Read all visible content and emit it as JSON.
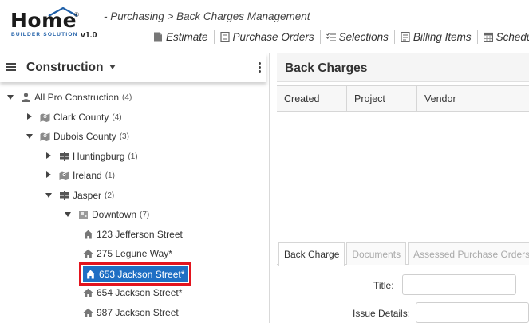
{
  "app": {
    "logo_word": "Home",
    "logo_sub": "BUILDER SOLUTION",
    "logo_version": "v1.0",
    "logo_reg": "®"
  },
  "breadcrumb": "- Purchasing > Back Charges Management",
  "toolbar": {
    "items": [
      {
        "label": "Estimate",
        "icon": "document-icon"
      },
      {
        "label": "Purchase Orders",
        "icon": "form-icon"
      },
      {
        "label": "Selections",
        "icon": "checklist-icon"
      },
      {
        "label": "Billing Items",
        "icon": "billing-icon"
      },
      {
        "label": "Schedul",
        "icon": "calendar-icon"
      }
    ]
  },
  "left_panel": {
    "title": "Construction",
    "tree": [
      {
        "label": "All Pro Construction",
        "count": "(4)",
        "icon": "person-icon",
        "toggle": "down"
      },
      {
        "label": "Clark County",
        "count": "(4)",
        "icon": "map-icon",
        "toggle": "right"
      },
      {
        "label": "Dubois County",
        "count": "(3)",
        "icon": "map-icon",
        "toggle": "down"
      },
      {
        "label": "Huntingburg",
        "count": "(1)",
        "icon": "signpost-icon",
        "toggle": "right"
      },
      {
        "label": "Ireland",
        "count": "(1)",
        "icon": "map-icon",
        "toggle": "right"
      },
      {
        "label": "Jasper",
        "count": "(2)",
        "icon": "signpost-icon",
        "toggle": "down"
      },
      {
        "label": "Downtown",
        "count": "(7)",
        "icon": "subdivision-icon",
        "toggle": "down"
      },
      {
        "label": "123 Jefferson Street",
        "count": "",
        "icon": "house-icon",
        "toggle": ""
      },
      {
        "label": "275 Legune Way*",
        "count": "",
        "icon": "house-icon",
        "toggle": ""
      },
      {
        "label": "653 Jackson Street*",
        "count": "",
        "icon": "house-icon",
        "toggle": "",
        "selected": true
      },
      {
        "label": "654 Jackson Street*",
        "count": "",
        "icon": "house-icon",
        "toggle": ""
      },
      {
        "label": "987 Jackson Street",
        "count": "",
        "icon": "house-icon",
        "toggle": ""
      }
    ]
  },
  "right_panel": {
    "title": "Back Charges",
    "columns": [
      "Created",
      "Project",
      "Vendor"
    ],
    "tabs": [
      "Back Charge",
      "Documents",
      "Assessed Purchase Orders"
    ],
    "active_tab": "Back Charge",
    "form": {
      "title_label": "Title:",
      "title_value": "",
      "issue_label": "Issue Details:",
      "issue_value": ""
    }
  },
  "colors": {
    "selection_bg": "#1f6fc4",
    "selection_outline": "#e3141e",
    "logo_blue": "#1f5fa8"
  }
}
